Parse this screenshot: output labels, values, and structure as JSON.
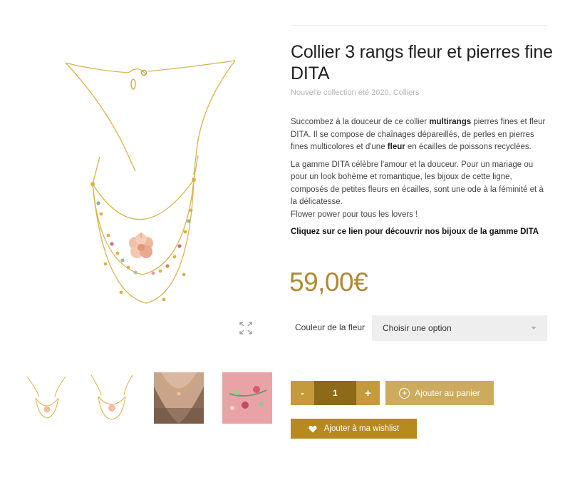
{
  "product": {
    "title": "Collier 3 rangs fleur et pierres fine DITA",
    "categories": [
      "Nouvelle collection été 2020",
      "Colliers"
    ],
    "category_separator": ", ",
    "description": {
      "p1_before": "Succombez à la douceur de ce collier ",
      "p1_bold1": "multirangs",
      "p1_middle": " pierres fines et fleur DITA. Il se compose de chaînages dépareillés, de perles en pierres fines multicolores et d'une ",
      "p1_bold2": "fleur",
      "p1_after": " en écailles de poissons recyclées.",
      "p2": "La gamme DITA célèbre l'amour et la douceur. Pour un mariage ou pour un look bohème et romantique, les bijoux de cette ligne, composés de petites fleurs en écailles, sont une ode à la féminité et à la délicatesse.",
      "p3": "Flower power pour tous les lovers !",
      "link": "Cliquez sur ce lien pour découvrir nos bijoux de la gamme DITA"
    },
    "price": "59,00€"
  },
  "variation": {
    "label": "Couleur de la fleur",
    "selected": "Choisir une option"
  },
  "cart": {
    "minus": "-",
    "quantity": "1",
    "plus": "+",
    "add_label": "Ajouter au panier",
    "add_icon": "plus-circle-icon",
    "wishlist_label": "Ajouter à ma wishlist",
    "wishlist_icon": "heart-icon"
  },
  "gallery": {
    "zoom_icon": "expand-icon",
    "thumbnails": [
      "necklace-front",
      "necklace-detail",
      "worn-on-model",
      "flowers-on-pink"
    ]
  },
  "colors": {
    "price": "#b08a32",
    "qty_button": "#c49a3a",
    "qty_value_bg": "#8c6a17",
    "add_to_cart": "#cdab5e",
    "wishlist": "#b8891f",
    "select_bg": "#eeeeee"
  }
}
